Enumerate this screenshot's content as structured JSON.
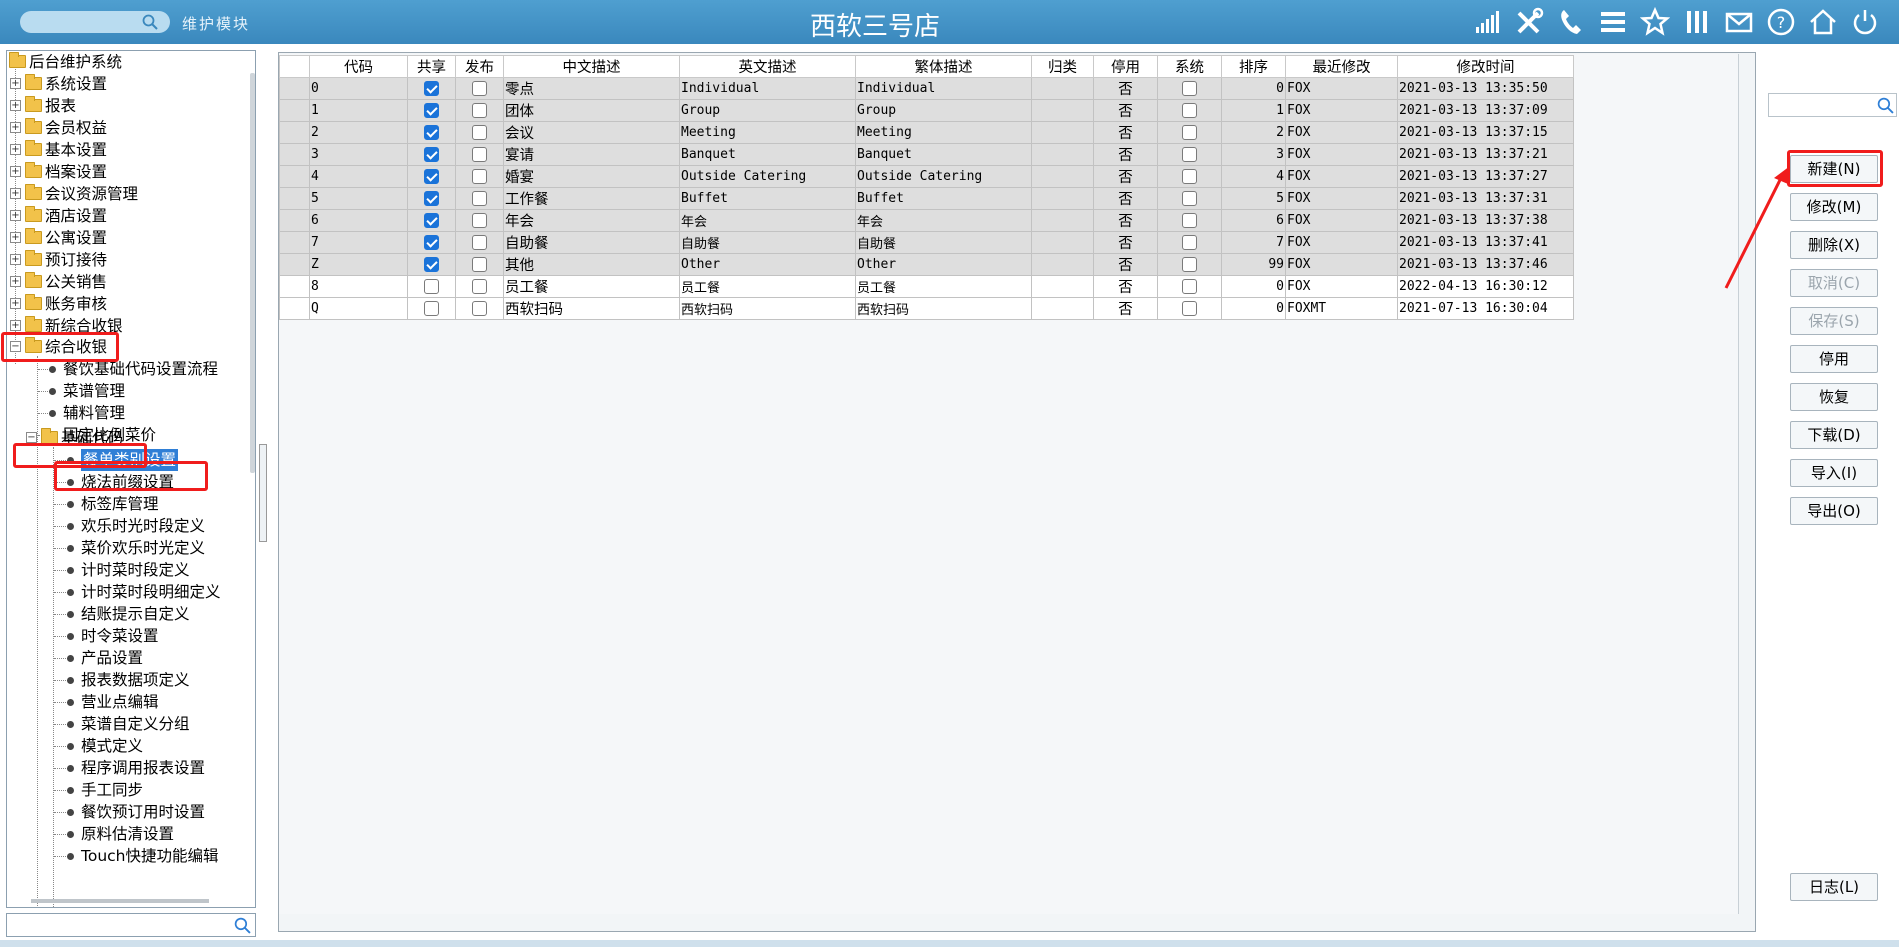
{
  "header": {
    "module_label": "维护模块",
    "store_title": "西软三号店",
    "icons": [
      "signal-icon",
      "tools-icon",
      "phone-icon",
      "menu-icon",
      "star-icon",
      "columns-icon",
      "mail-icon",
      "help-icon",
      "home-icon",
      "power-icon"
    ]
  },
  "tree": {
    "root": "后台维护系统",
    "top_items": [
      "系统设置",
      "报表",
      "会员权益",
      "基本设置",
      "档案设置",
      "会议资源管理",
      "酒店设置",
      "公寓设置",
      "预订接待",
      "公关销售",
      "账务审核",
      "新综合收银"
    ],
    "expanded": "综合收银",
    "sub_items": [
      "餐饮基础代码设置流程",
      "菜谱管理",
      "辅料管理",
      "固定比例菜价"
    ],
    "base_code_folder": "基础代码",
    "base_code_items": [
      "餐单类别设置",
      "烧法前缀设置",
      "标签库管理",
      "欢乐时光时段定义",
      "菜价欢乐时光定义",
      "计时菜时段定义",
      "计时菜时段明细定义",
      "结账提示自定义",
      "时令菜设置",
      "产品设置",
      "报表数据项定义",
      "营业点编辑",
      "菜谱自定义分组",
      "模式定义",
      "程序调用报表设置",
      "手工同步",
      "餐饮预订用时设置",
      "原料估清设置",
      "Touch快捷功能编辑"
    ]
  },
  "grid": {
    "columns": [
      "代码",
      "共享",
      "发布",
      "中文描述",
      "英文描述",
      "繁体描述",
      "归类",
      "停用",
      "系统",
      "排序",
      "最近修改",
      "修改时间"
    ],
    "rows": [
      {
        "code": "0",
        "share": true,
        "publish": false,
        "cn": "零点",
        "en": "Individual",
        "tw": "Individual",
        "cat": "",
        "disabled": "否",
        "system": false,
        "order": "0",
        "modifier": "FOX",
        "time": "2021-03-13 13:35:50",
        "shade": "gray"
      },
      {
        "code": "1",
        "share": true,
        "publish": false,
        "cn": "团体",
        "en": "Group",
        "tw": "Group",
        "cat": "",
        "disabled": "否",
        "system": false,
        "order": "1",
        "modifier": "FOX",
        "time": "2021-03-13 13:37:09",
        "shade": "gray"
      },
      {
        "code": "2",
        "share": true,
        "publish": false,
        "cn": "会议",
        "en": "Meeting",
        "tw": "Meeting",
        "cat": "",
        "disabled": "否",
        "system": false,
        "order": "2",
        "modifier": "FOX",
        "time": "2021-03-13 13:37:15",
        "shade": "gray"
      },
      {
        "code": "3",
        "share": true,
        "publish": false,
        "cn": "宴请",
        "en": "Banquet",
        "tw": "Banquet",
        "cat": "",
        "disabled": "否",
        "system": false,
        "order": "3",
        "modifier": "FOX",
        "time": "2021-03-13 13:37:21",
        "shade": "gray"
      },
      {
        "code": "4",
        "share": true,
        "publish": false,
        "cn": "婚宴",
        "en": "Outside Catering",
        "tw": "Outside Catering",
        "cat": "",
        "disabled": "否",
        "system": false,
        "order": "4",
        "modifier": "FOX",
        "time": "2021-03-13 13:37:27",
        "shade": "gray"
      },
      {
        "code": "5",
        "share": true,
        "publish": false,
        "cn": "工作餐",
        "en": "Buffet",
        "tw": "Buffet",
        "cat": "",
        "disabled": "否",
        "system": false,
        "order": "5",
        "modifier": "FOX",
        "time": "2021-03-13 13:37:31",
        "shade": "gray"
      },
      {
        "code": "6",
        "share": true,
        "publish": false,
        "cn": "年会",
        "en": "年会",
        "tw": "年会",
        "cat": "",
        "disabled": "否",
        "system": false,
        "order": "6",
        "modifier": "FOX",
        "time": "2021-03-13 13:37:38",
        "shade": "gray"
      },
      {
        "code": "7",
        "share": true,
        "publish": false,
        "cn": "自助餐",
        "en": "自助餐",
        "tw": "自助餐",
        "cat": "",
        "disabled": "否",
        "system": false,
        "order": "7",
        "modifier": "FOX",
        "time": "2021-03-13 13:37:41",
        "shade": "gray"
      },
      {
        "code": "Z",
        "share": true,
        "publish": false,
        "cn": "其他",
        "en": "Other",
        "tw": "Other",
        "cat": "",
        "disabled": "否",
        "system": false,
        "order": "99",
        "modifier": "FOX",
        "time": "2021-03-13 13:37:46",
        "shade": "gray"
      },
      {
        "code": "8",
        "share": false,
        "publish": false,
        "cn": "员工餐",
        "en": "员工餐",
        "tw": "员工餐",
        "cat": "",
        "disabled": "否",
        "system": false,
        "order": "0",
        "modifier": "FOX",
        "time": "2022-04-13 16:30:12",
        "shade": "white"
      },
      {
        "code": "Q",
        "share": false,
        "publish": false,
        "cn": "西软扫码",
        "en": "西软扫码",
        "tw": "西软扫码",
        "cat": "",
        "disabled": "否",
        "system": false,
        "order": "0",
        "modifier": "FOXMT",
        "time": "2021-07-13 16:30:04",
        "shade": "white"
      }
    ]
  },
  "buttons": {
    "new": "新建(N)",
    "edit": "修改(M)",
    "delete": "删除(X)",
    "cancel": "取消(C)",
    "save": "保存(S)",
    "stop": "停用",
    "restore": "恢复",
    "download": "下载(D)",
    "import": "导入(I)",
    "export": "导出(O)",
    "log": "日志(L)"
  },
  "colors": {
    "header": "#3f8fc4",
    "annotation": "#f01c1c",
    "selection": "#2f7fd6",
    "checkbox_on": "#1a73d9"
  }
}
